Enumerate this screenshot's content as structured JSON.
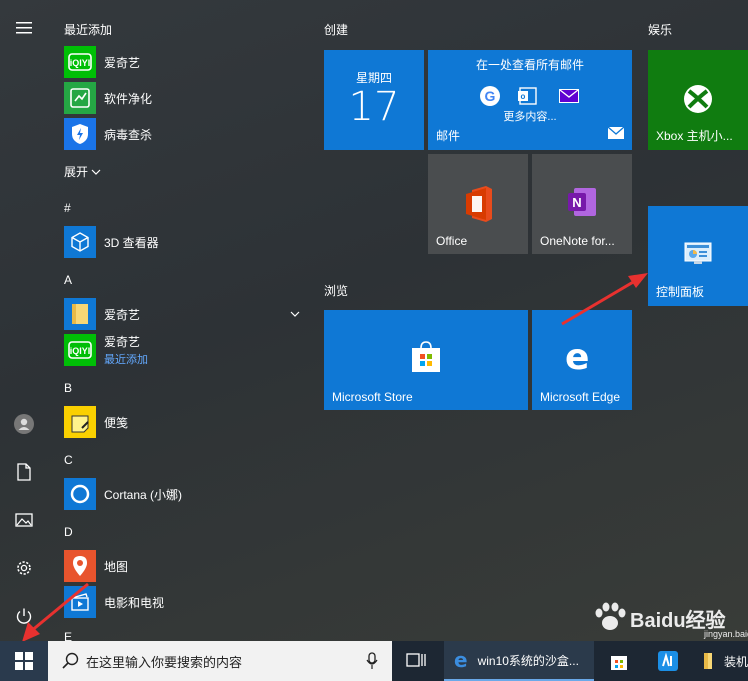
{
  "rail": {
    "icons": [
      "hamburger-icon",
      "user-icon",
      "document-icon",
      "pictures-icon",
      "settings-icon",
      "power-icon"
    ]
  },
  "app_list": {
    "recent_header": "最近添加",
    "recent": [
      {
        "label": "爱奇艺",
        "icon": "iqiyi-icon"
      },
      {
        "label": "软件净化",
        "icon": "software-clean-icon"
      },
      {
        "label": "病毒查杀",
        "icon": "antivirus-icon"
      }
    ],
    "expand_label": "展开",
    "sections": [
      {
        "letter": "#",
        "apps": [
          {
            "label": "3D 查看器",
            "icon": "3d-viewer-icon"
          }
        ]
      },
      {
        "letter": "A",
        "apps": [
          {
            "label": "爱奇艺",
            "icon": "folder-icon"
          },
          {
            "label": "爱奇艺",
            "sub": "最近添加",
            "icon": "iqiyi-icon"
          }
        ]
      },
      {
        "letter": "B",
        "apps": [
          {
            "label": "便笺",
            "icon": "sticky-notes-icon"
          }
        ]
      },
      {
        "letter": "C",
        "apps": [
          {
            "label": "Cortana (小娜)",
            "icon": "cortana-icon"
          }
        ]
      },
      {
        "letter": "D",
        "apps": [
          {
            "label": "地图",
            "icon": "maps-icon"
          },
          {
            "label": "电影和电视",
            "icon": "movies-tv-icon"
          }
        ]
      },
      {
        "letter": "E",
        "apps": []
      }
    ]
  },
  "groups": {
    "create": "创建",
    "browse": "浏览",
    "entertainment": "娱乐"
  },
  "tiles": {
    "calendar": {
      "day_name": "星期四",
      "day_number": "17"
    },
    "mail": {
      "title": "在一处查看所有邮件",
      "more": "更多内容...",
      "label": "邮件"
    },
    "office": {
      "label": "Office"
    },
    "onenote": {
      "label": "OneNote for..."
    },
    "xbox": {
      "label": "Xbox 主机小..."
    },
    "control_panel": {
      "label": "控制面板"
    },
    "store": {
      "label": "Microsoft Store"
    },
    "edge": {
      "label": "Microsoft Edge"
    }
  },
  "taskbar": {
    "search_placeholder": "在这里输入你要搜索的内容",
    "edge_window": "win10系统的沙盒...",
    "last_item": "装机"
  },
  "watermark": {
    "brand": "Baidu经验",
    "url": "jingyan.baidu.com"
  },
  "colors": {
    "tile_blue": "#0f78d5",
    "xbox_green": "#107c10",
    "arrow_red": "#e8312f"
  }
}
